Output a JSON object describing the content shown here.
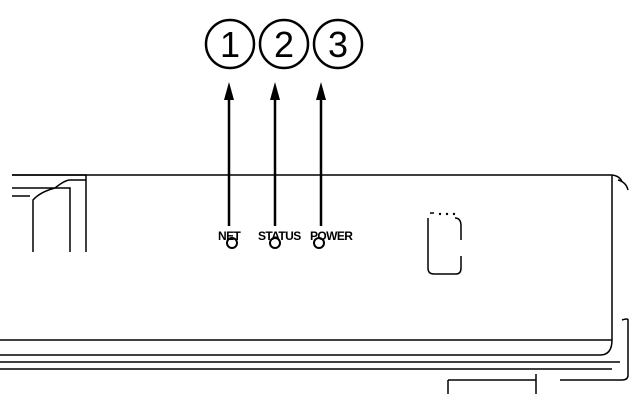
{
  "callouts": [
    {
      "number": "1"
    },
    {
      "number": "2"
    },
    {
      "number": "3"
    }
  ],
  "indicators": [
    {
      "label": "NET"
    },
    {
      "label": "STATUS"
    },
    {
      "label": "POWER"
    }
  ],
  "colors": {
    "line": "#000000",
    "background": "#ffffff"
  }
}
